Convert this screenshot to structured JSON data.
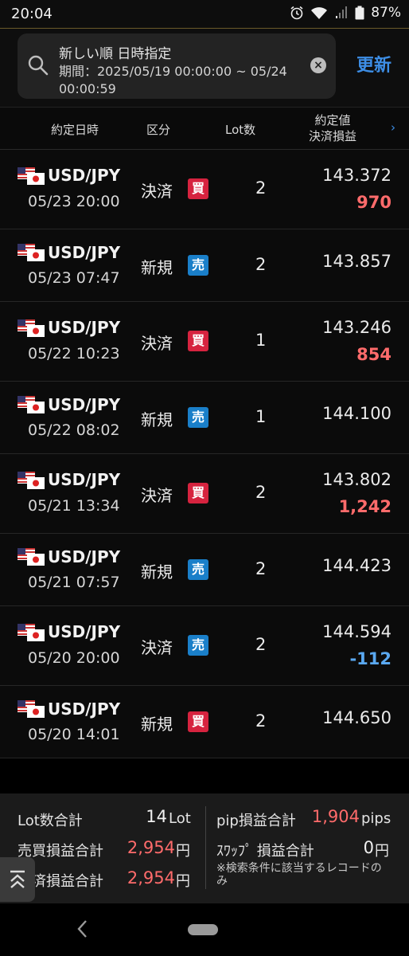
{
  "status_bar": {
    "time": "20:04",
    "battery": "87%"
  },
  "search": {
    "sort_label": "新しい順 日時指定",
    "period_label": "期間：2025/05/19 00:00:00 ~ 05/24 00:00:59",
    "clear_icon": "clear-icon",
    "refresh_label": "更新"
  },
  "columns": {
    "date": "約定日時",
    "kubun": "区分",
    "lot": "Lot数",
    "price_line1": "約定値",
    "price_line2": "決済損益"
  },
  "rows": [
    {
      "pair": "USD/JPY",
      "datetime": "05/23 20:00",
      "kubun": "決済",
      "side": "買",
      "lot": "2",
      "price": "143.372",
      "pl": "970"
    },
    {
      "pair": "USD/JPY",
      "datetime": "05/23 07:47",
      "kubun": "新規",
      "side": "売",
      "lot": "2",
      "price": "143.857",
      "pl": ""
    },
    {
      "pair": "USD/JPY",
      "datetime": "05/22 10:23",
      "kubun": "決済",
      "side": "買",
      "lot": "1",
      "price": "143.246",
      "pl": "854"
    },
    {
      "pair": "USD/JPY",
      "datetime": "05/22 08:02",
      "kubun": "新規",
      "side": "売",
      "lot": "1",
      "price": "144.100",
      "pl": ""
    },
    {
      "pair": "USD/JPY",
      "datetime": "05/21 13:34",
      "kubun": "決済",
      "side": "買",
      "lot": "2",
      "price": "143.802",
      "pl": "1,242"
    },
    {
      "pair": "USD/JPY",
      "datetime": "05/21 07:57",
      "kubun": "新規",
      "side": "売",
      "lot": "2",
      "price": "144.423",
      "pl": ""
    },
    {
      "pair": "USD/JPY",
      "datetime": "05/20 20:00",
      "kubun": "決済",
      "side": "売",
      "lot": "2",
      "price": "144.594",
      "pl": "-112"
    },
    {
      "pair": "USD/JPY",
      "datetime": "05/20 14:01",
      "kubun": "新規",
      "side": "買",
      "lot": "2",
      "price": "144.650",
      "pl": ""
    }
  ],
  "summary": {
    "lot_total_label": "Lot数合計",
    "lot_total_value": "14",
    "lot_total_unit": "Lot",
    "trade_pl_label": "売買損益合計",
    "trade_pl_value": "2,954",
    "yen_unit": "円",
    "settle_pl_label": "決済損益合計",
    "settle_pl_value": "2,954",
    "pip_pl_label": "pip損益合計",
    "pip_pl_value": "1,904",
    "pip_unit": "pips",
    "swap_label": "ｽﾜｯﾌﾟ 損益合計",
    "swap_value": "0",
    "note": "※検索条件に該当するレコードのみ"
  },
  "colors": {
    "accent": "#3d8ee6",
    "buy": "#d6233f",
    "sell": "#1a7fc9",
    "profit": "#ff6b6b",
    "loss": "#5aa8f0"
  }
}
